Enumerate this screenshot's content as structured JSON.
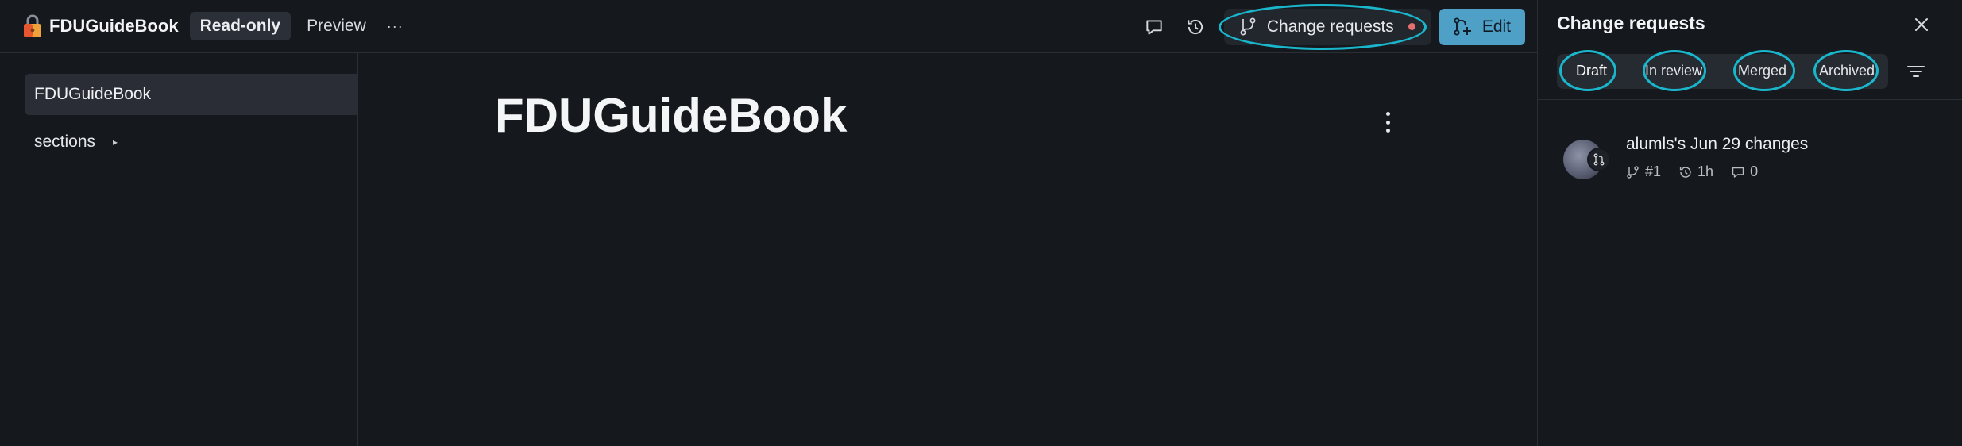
{
  "header": {
    "space_name": "FDUGuideBook",
    "read_only_label": "Read-only",
    "preview_label": "Preview",
    "more_label": "···",
    "change_requests_label": "Change requests",
    "edit_label": "Edit"
  },
  "sidebar": {
    "items": [
      {
        "label": "FDUGuideBook"
      },
      {
        "label": "sections"
      }
    ]
  },
  "main": {
    "title": "FDUGuideBook"
  },
  "panel": {
    "title": "Change requests",
    "tabs": [
      {
        "label": "Draft"
      },
      {
        "label": "In review"
      },
      {
        "label": "Merged"
      },
      {
        "label": "Archived"
      }
    ],
    "items": [
      {
        "title": "alumls's Jun 29 changes",
        "number": "#1",
        "age": "1h",
        "comments": "0"
      }
    ]
  },
  "colors": {
    "background": "#15181d",
    "accent": "#4ea0c6",
    "highlight_ring": "#19b6cc",
    "status_dot": "#e4716f"
  },
  "icons": [
    "lock-icon",
    "comment-icon",
    "history-icon",
    "branch-icon",
    "edit-branch-icon",
    "close-icon",
    "filter-icon",
    "kebab-icon",
    "caret-right-icon"
  ]
}
